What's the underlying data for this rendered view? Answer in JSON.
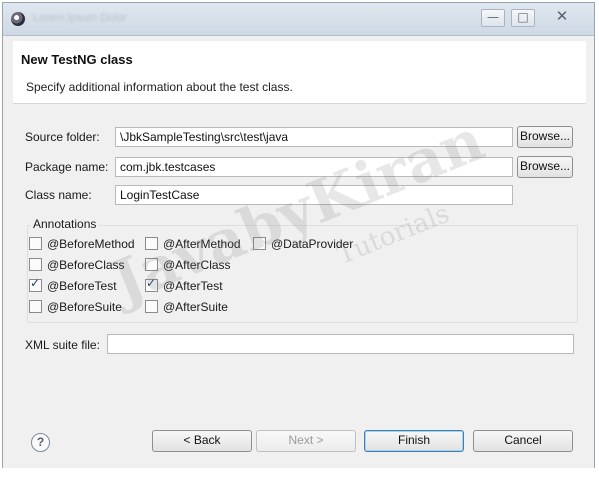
{
  "window": {
    "min_glyph": "—",
    "max_glyph": "□",
    "close_glyph": "✕"
  },
  "header": {
    "title": "New TestNG class",
    "description": "Specify additional information about the test class."
  },
  "form": {
    "source_folder": {
      "label": "Source folder:",
      "value": "\\JbkSampleTesting\\src\\test\\java",
      "browse_label": "Browse..."
    },
    "package_name": {
      "label": "Package name:",
      "value": "com.jbk.testcases",
      "browse_label": "Browse..."
    },
    "class_name": {
      "label": "Class name:",
      "value": "LoginTestCase"
    }
  },
  "annotations": {
    "legend": "Annotations",
    "items": [
      {
        "label": "@BeforeMethod",
        "checked": false
      },
      {
        "label": "@AfterMethod",
        "checked": false
      },
      {
        "label": "@DataProvider",
        "checked": false
      },
      {
        "label": "@BeforeClass",
        "checked": false
      },
      {
        "label": "@AfterClass",
        "checked": false
      },
      {
        "label": "@BeforeTest",
        "checked": true
      },
      {
        "label": "@AfterTest",
        "checked": true
      },
      {
        "label": "@BeforeSuite",
        "checked": false
      },
      {
        "label": "@AfterSuite",
        "checked": false
      }
    ]
  },
  "xml_suite": {
    "label": "XML suite file:",
    "value": ""
  },
  "footer": {
    "help_glyph": "?",
    "back_label": "< Back",
    "next_label": "Next >",
    "finish_label": "Finish",
    "cancel_label": "Cancel"
  },
  "watermark": {
    "main": "JavabyKiran",
    "sub": "Tutorials"
  },
  "colors": {
    "accent_border": "#3c7fb1",
    "window_bg": "#f0f0f0",
    "check_color": "#1e3e6e"
  }
}
